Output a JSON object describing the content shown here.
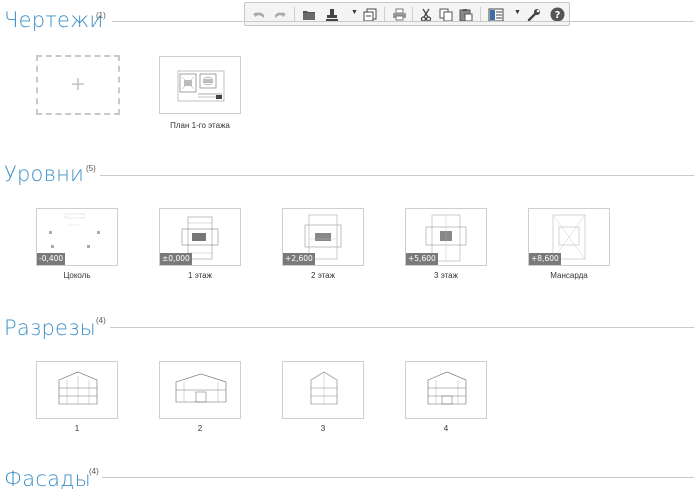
{
  "sections": [
    {
      "title": "Чертежи",
      "count": "(1)"
    },
    {
      "title": "Уровни",
      "count": "(5)"
    },
    {
      "title": "Разрезы",
      "count": "(4)"
    },
    {
      "title": "Фасады",
      "count": "(4)"
    }
  ],
  "add_tile": {
    "symbol": "+"
  },
  "drawings": [
    {
      "label": "План 1-го этажа"
    }
  ],
  "levels": [
    {
      "label": "Цоколь",
      "elevation": "-0,400"
    },
    {
      "label": "1 этаж",
      "elevation": "±0,000"
    },
    {
      "label": "2 этаж",
      "elevation": "+2,600"
    },
    {
      "label": "3 этаж",
      "elevation": "+5,600"
    },
    {
      "label": "Мансарда",
      "elevation": "+8,600"
    }
  ],
  "sections_views": [
    {
      "label": "1"
    },
    {
      "label": "2"
    },
    {
      "label": "3"
    },
    {
      "label": "4"
    }
  ],
  "toolbar": {
    "buttons": [
      "undo-icon",
      "redo-icon",
      "folder-icon",
      "stamp-icon",
      "copy-views-icon",
      "print-icon",
      "cut-icon",
      "copy-icon",
      "paste-icon",
      "layout-icon",
      "wrench-icon",
      "help-icon"
    ]
  },
  "colors": {
    "accent": "#3d8fc7",
    "badge": "#7a7a7a",
    "divider": "#c9c9c9"
  }
}
